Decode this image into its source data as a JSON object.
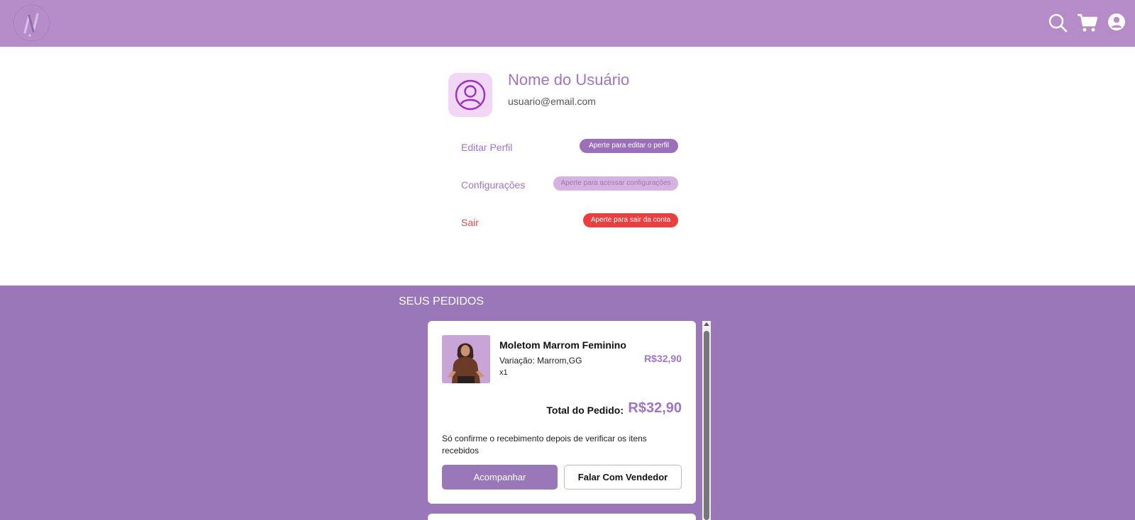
{
  "header": {
    "logo_icon": "n-logo-icon",
    "icons": [
      "search-icon",
      "cart-icon",
      "user-icon"
    ],
    "background": "#b58bc8"
  },
  "profile": {
    "name": "Nome do Usuário",
    "email": "usuario@email.com",
    "avatar_icon": "user-avatar-icon",
    "menu": [
      {
        "label": "Editar Perfil",
        "hint": "Aperte para editar o perfil",
        "color": "#9b70b9"
      },
      {
        "label": "Configurações",
        "hint": "Aperte para acessar configurações",
        "color": "#d6b2e2"
      },
      {
        "label": "Sair",
        "hint": "Aperte para sair da conta",
        "color": "#e9403f"
      }
    ]
  },
  "orders": {
    "title": "SEUS PEDIDOS",
    "items": [
      {
        "product_name": "Moletom Marrom Feminino",
        "variation": "Variação: Marrom,GG",
        "quantity": "x1",
        "price": "R$32,90",
        "total_label": "Total do Pedido:",
        "total_value": "R$32,90",
        "notice": "Só confirme o recebimento depois de verificar os itens recebidos",
        "primary_action": "Acompanhar",
        "secondary_action": "Falar Com Vendedor"
      }
    ]
  },
  "colors": {
    "accent": "#a074c4",
    "orders_bg": "#9977b8",
    "danger": "#e9403f"
  }
}
